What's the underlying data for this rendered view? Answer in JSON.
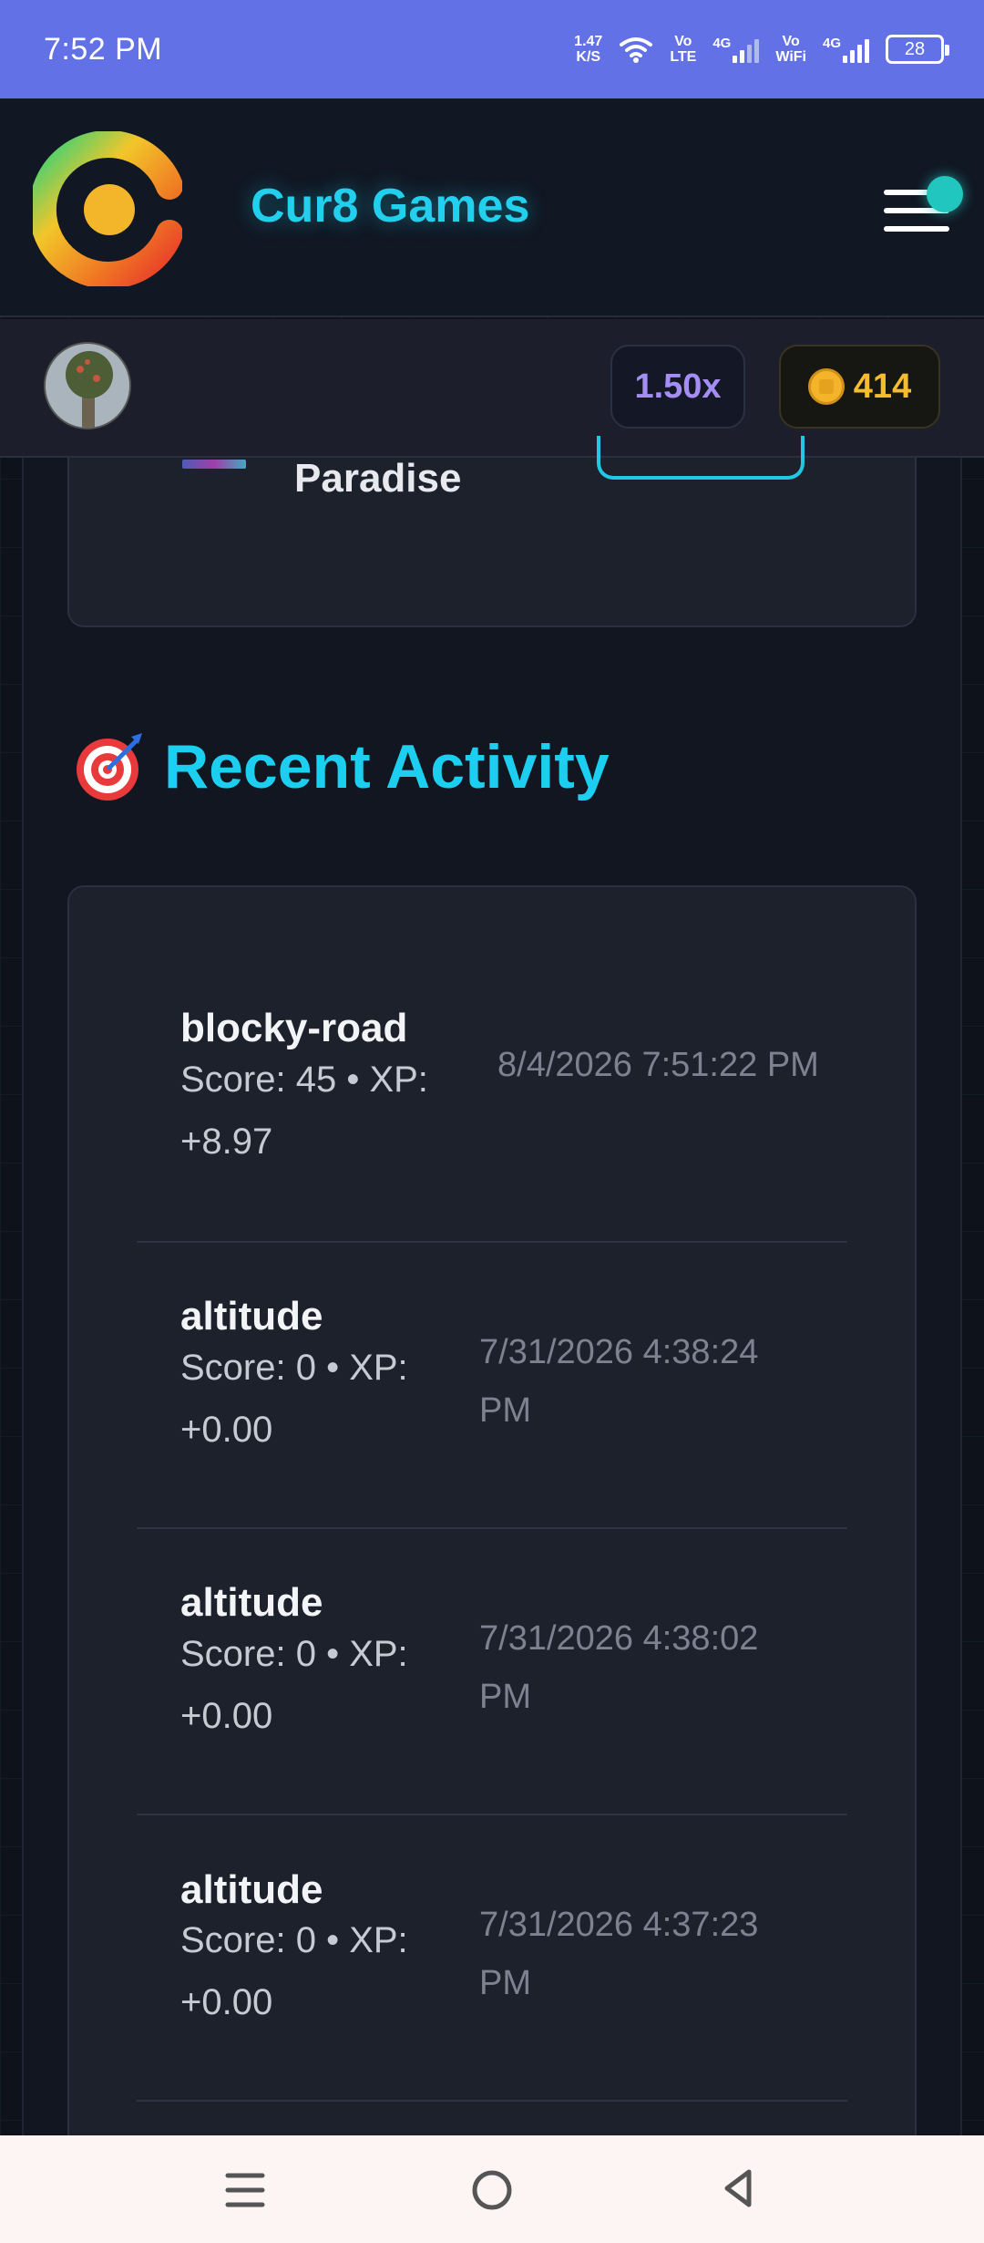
{
  "status_bar": {
    "time": "7:52 PM",
    "net_speed_value": "1.47",
    "net_speed_unit": "K/S",
    "volte_top": "Vo",
    "volte_bottom": "LTE",
    "lte_label": "4G",
    "wifi_call_top": "Vo",
    "wifi_call_bottom": "WiFi",
    "lte_label_2": "4G",
    "battery": "28"
  },
  "header": {
    "brand": "Cur8 Games",
    "logo_icon": "cur8-logo-icon",
    "menu_icon": "hamburger-menu-icon"
  },
  "user_bar": {
    "multiplier": "1.50x",
    "coins": "414"
  },
  "featured_game": {
    "name": "Paradise"
  },
  "recent_activity": {
    "title": "Recent Activity",
    "icon": "target-icon",
    "items": [
      {
        "game": "blocky-road",
        "meta": "Score: 45 • XP: +8.97",
        "timestamp": "8/4/2026 7:51:22 PM"
      },
      {
        "game": "altitude",
        "meta": "Score: 0 • XP: +0.00",
        "timestamp": "7/31/2026 4:38:24 PM"
      },
      {
        "game": "altitude",
        "meta": "Score: 0 • XP: +0.00",
        "timestamp": "7/31/2026 4:38:02 PM"
      },
      {
        "game": "altitude",
        "meta": "Score: 0 • XP: +0.00",
        "timestamp": "7/31/2026 4:37:23 PM"
      }
    ]
  },
  "colors": {
    "accent_cyan": "#1ccff0",
    "status_bar": "#6272e6",
    "coin_gold": "#f5bd2e",
    "multiplier_purple": "#a48ef5"
  }
}
